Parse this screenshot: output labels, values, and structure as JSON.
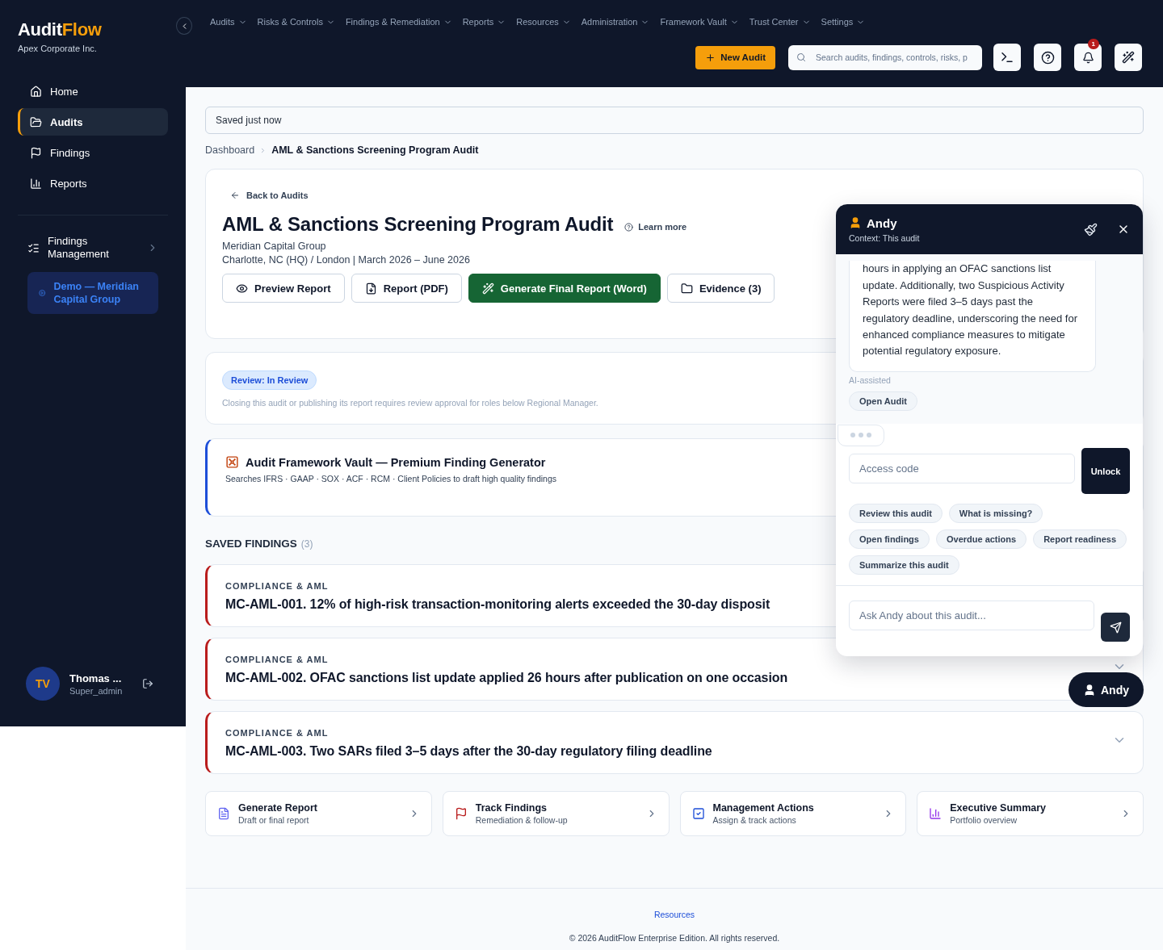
{
  "brand": {
    "name_main": "Audit",
    "name_accent": "Flow",
    "org": "Apex Corporate Inc."
  },
  "sidebar": {
    "items": [
      {
        "label": "Home",
        "selected": false
      },
      {
        "label": "Audits",
        "selected": true
      },
      {
        "label": "Findings",
        "selected": false
      },
      {
        "label": "Reports",
        "selected": false
      }
    ],
    "group": {
      "label": "Findings Management",
      "expanded": false
    },
    "demo": {
      "label": "Demo — Meridian Capital Group"
    },
    "user": {
      "initials": "TV",
      "name": "Thomas ...",
      "role": "Super_admin"
    }
  },
  "topnav": {
    "items": [
      "Audits",
      "Risks & Controls",
      "Findings & Remediation",
      "Reports",
      "Resources",
      "Administration",
      "Framework Vault",
      "Trust Center",
      "Settings"
    ]
  },
  "toolbar": {
    "new_button": "New Audit",
    "search": {
      "placeholder": "Search audits, findings, controls, risks, p"
    },
    "notification_count": "1"
  },
  "save_status": "Saved just now",
  "breadcrumb": [
    "Dashboard",
    "AML & Sanctions Screening Program Audit"
  ],
  "audit": {
    "back": "Back to Audits",
    "title": "AML & Sanctions Screening Program Audit",
    "learn_more": "Learn more",
    "client": "Meridian Capital Group",
    "details": "Charlotte, NC (HQ) / London | March 2026 – June 2026",
    "actions": [
      {
        "label": "Preview Report",
        "kind": "outline"
      },
      {
        "label": "Report (PDF)",
        "kind": "outline"
      },
      {
        "label": "Generate Final Report (Word)",
        "kind": "primary"
      },
      {
        "label": "Evidence (3)",
        "kind": "outline"
      }
    ]
  },
  "review": {
    "badge": "Review: In Review",
    "note": "Closing this audit or publishing its report requires review approval for roles below Regional Manager."
  },
  "vault": {
    "title": "Audit Framework Vault — Premium Finding Generator",
    "subtitle": "Searches IFRS · GAAP · SOX · ACF · RCM · Client Policies to draft high quality findings"
  },
  "saved_findings": {
    "heading": "SAVED FINDINGS",
    "count": "(3)",
    "items": [
      {
        "category": "COMPLIANCE & AML",
        "title": "MC-AML-001. 12% of high-risk transaction-monitoring alerts exceeded the 30-day disposit"
      },
      {
        "category": "COMPLIANCE & AML",
        "title": "MC-AML-002. OFAC sanctions list update applied 26 hours after publication on one occasion"
      },
      {
        "category": "COMPLIANCE & AML",
        "title": "MC-AML-003. Two SARs filed 3–5 days after the 30-day regulatory filing deadline"
      }
    ]
  },
  "quick_links": [
    {
      "title": "Generate Report",
      "subtitle": "Draft or final report"
    },
    {
      "title": "Track Findings",
      "subtitle": "Remediation & follow-up"
    },
    {
      "title": "Management Actions",
      "subtitle": "Assign & track actions"
    },
    {
      "title": "Executive Summary",
      "subtitle": "Portfolio overview"
    }
  ],
  "footer": {
    "link": "Resources",
    "copyright": "© 2026 AuditFlow Enterprise Edition. All rights reserved."
  },
  "assistant": {
    "name": "Andy",
    "context": "Context: This audit",
    "message": "hours in applying an OFAC sanctions list update. Additionally, two Suspicious Activity Reports were filed 3–5 days past the regulatory deadline, underscoring the need for enhanced compliance measures to mitigate potential regulatory exposure.",
    "message_note": "AI-assisted",
    "message_action": "Open Audit",
    "typing": true,
    "access": {
      "placeholder": "Access code",
      "button": "Unlock"
    },
    "suggestions": [
      "Review this audit",
      "What is missing?",
      "Open findings",
      "Overdue actions",
      "Report readiness",
      "Summarize this audit"
    ],
    "ask": {
      "placeholder": "Ask Andy about this audit..."
    },
    "launcher": "Andy"
  }
}
